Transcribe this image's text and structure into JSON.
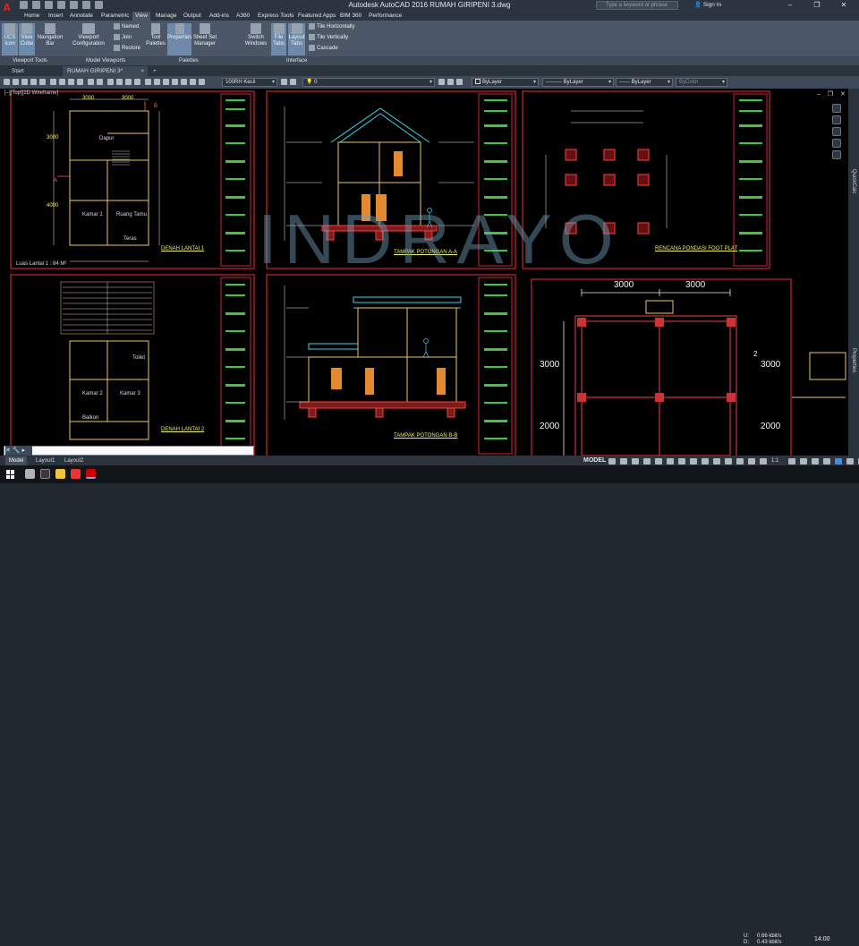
{
  "window": {
    "title": "Autodesk AutoCAD 2016   RUMAH GIRIPENI 3.dwg",
    "search_placeholder": "Type a keyword or phrase",
    "signin": "Sign In",
    "minimize": "–",
    "maximize": "❐",
    "close": "✕",
    "app_logo": "A"
  },
  "menu": {
    "tabs": [
      "Home",
      "Insert",
      "Annotate",
      "Parametric",
      "View",
      "Manage",
      "Output",
      "Add-ins",
      "A360",
      "Express Tools",
      "Featured Apps",
      "BIM 360",
      "Performance"
    ],
    "active": "View"
  },
  "ribbon": {
    "ucs_icon": "UCS Icon",
    "view_cube": "View Cube",
    "navigation_bar": "Navigation Bar",
    "viewport_configuration": "Viewport Configuration",
    "named": "Named",
    "join": "Join",
    "restore": "Restore",
    "tool_palettes": "Tool Palettes",
    "properties": "Properties",
    "sheet_set_manager": "Sheet Set Manager",
    "switch_windows": "Switch Windows",
    "file_tabs": "File Tabs",
    "layout_tabs": "Layout Tabs",
    "tile_horizontally": "Tile Horizontally",
    "tile_vertically": "Tile Vertically",
    "cascade": "Cascade",
    "panel_viewport_tools": "Viewport Tools",
    "panel_model_viewports": "Model Viewports",
    "panel_palettes": "Palettes",
    "panel_interface": "Interface"
  },
  "document_tabs": {
    "start": "Start",
    "current": "RUMAH GIRIPENI 3*",
    "close": "×",
    "add": "+"
  },
  "properties_bar": {
    "text_style": "100RH Kecil",
    "layer": "0",
    "color": "ByLayer",
    "linetype": "ByLayer",
    "lineweight": "ByLayer",
    "plotstyle": "ByColor"
  },
  "viewport": {
    "label": "[–][Top][2D Wireframe]",
    "controls": "– ❐ ✕",
    "watermark": "INDRAYO",
    "side_quickcalc": "QuickCalc",
    "side_properties": "Properties"
  },
  "drawings": {
    "denah_lantai_1": "DENAH LANTAI 1",
    "denah_lantai_2": "DENAH LANTAI 2",
    "potongan_aa": "TAMPAK POTONGAN A-A",
    "potongan_bb": "TAMPAK POTONGAN B-B",
    "pondasi": "RENCANA PONDASI FOOT PLAT",
    "room_dapur": "Dapur",
    "room_kamar1": "Kamar 1",
    "room_ruang_tamu": "Ruang Tamu",
    "room_teras": "Teras",
    "room_kamar2": "Kamar 2",
    "room_kamar3": "Kamar 3",
    "room_balkon": "Balkon",
    "room_toilet": "Toilet",
    "luas_lantai": "Luas Lantai 1 : 84 M²",
    "dim_3000": "3000",
    "dim_4000": "4000",
    "dim_2000": "2000",
    "marker_a": "A",
    "marker_b": "B",
    "marker_2": "2"
  },
  "command_line": {
    "buttons": "✕ 🔧 ▸",
    "value": ""
  },
  "layout_tabs": [
    "Model",
    "Layout1",
    "Layout2"
  ],
  "status": {
    "model": "MODEL",
    "scale": "1:1"
  },
  "taskbar": {
    "ul_label": "U:",
    "dl_label": "D:",
    "upload": "0.66 kbit/s",
    "download": "0.43 kbit/s",
    "time": "14:00"
  }
}
